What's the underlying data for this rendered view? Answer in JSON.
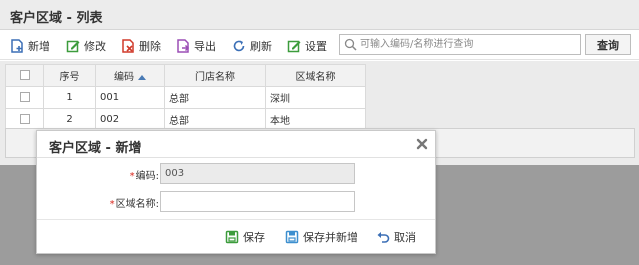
{
  "window": {
    "title": "客户区域 - 列表"
  },
  "toolbar": {
    "buttons": [
      {
        "label": "新增",
        "icon": "add-icon",
        "color": "#3b6fb6"
      },
      {
        "label": "修改",
        "icon": "edit-icon",
        "color": "#3c9c3c"
      },
      {
        "label": "删除",
        "icon": "delete-icon",
        "color": "#d03a2a"
      },
      {
        "label": "导出",
        "icon": "export-icon",
        "color": "#9b4fb5"
      },
      {
        "label": "刷新",
        "icon": "refresh-icon",
        "color": "#3b6fb6"
      },
      {
        "label": "设置",
        "icon": "settings-icon",
        "color": "#3c9c3c"
      }
    ]
  },
  "search": {
    "placeholder": "可输入编码/名称进行查询",
    "value": "",
    "query_label": "查询"
  },
  "grid": {
    "columns": [
      "序号",
      "编码",
      "门店名称",
      "区域名称"
    ],
    "rows": [
      {
        "num": "1",
        "code": "001",
        "store": "总部",
        "area": "深圳"
      },
      {
        "num": "2",
        "code": "002",
        "store": "总部",
        "area": "本地"
      }
    ]
  },
  "dialog": {
    "title": "客户区域 - 新增",
    "fields": {
      "code": {
        "label": "编码:",
        "required_mark": "*",
        "value": "003"
      },
      "area_name": {
        "label": "区域名称:",
        "required_mark": "*",
        "value": ""
      }
    },
    "buttons": {
      "save": "保存",
      "save_and_new": "保存并新增",
      "cancel": "取消"
    }
  },
  "colors": {
    "accent_blue": "#1a5fa8",
    "required_red": "#d9261c",
    "overlay": "#9c9c9c"
  }
}
